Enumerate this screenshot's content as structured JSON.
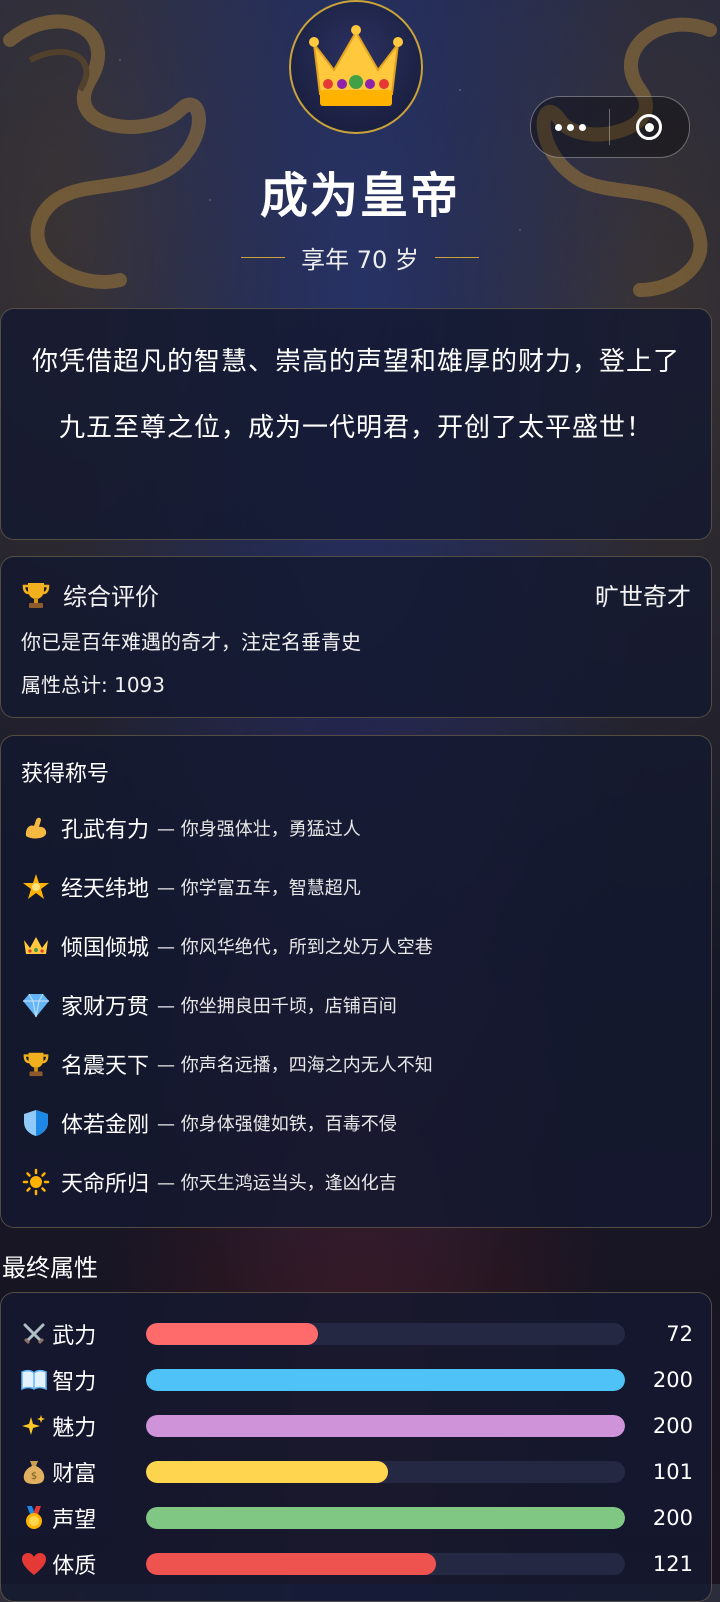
{
  "capsule": {
    "more_icon": "more-dots-icon",
    "close_icon": "target-close-icon"
  },
  "header": {
    "avatar_icon": "crown-icon",
    "title": "成为皇帝",
    "age": "享年 70 岁"
  },
  "description": "你凭借超凡的智慧、崇高的声望和雄厚的财力，登上了九五至尊之位，成为一代明君，开创了太平盛世！",
  "evaluation": {
    "icon": "trophy-icon",
    "label": "综合评价",
    "rank": "旷世奇才",
    "comment": "你已是百年难遇的奇才，注定名垂青史",
    "total": "属性总计: 1093"
  },
  "titles": {
    "heading": "获得称号",
    "items": [
      {
        "icon": "flexed-biceps-icon",
        "name": "孔武有力",
        "desc": "— 你身强体壮，勇猛过人"
      },
      {
        "icon": "glowing-star-icon",
        "name": "经天纬地",
        "desc": "— 你学富五车，智慧超凡"
      },
      {
        "icon": "crown-icon",
        "name": "倾国倾城",
        "desc": "— 你风华绝代，所到之处万人空巷"
      },
      {
        "icon": "gem-icon",
        "name": "家财万贯",
        "desc": "— 你坐拥良田千顷，店铺百间"
      },
      {
        "icon": "trophy-icon",
        "name": "名震天下",
        "desc": "— 你声名远播，四海之内无人不知"
      },
      {
        "icon": "shield-icon",
        "name": "体若金刚",
        "desc": "— 你身体强健如铁，百毒不侵"
      },
      {
        "icon": "sun-icon",
        "name": "天命所归",
        "desc": "— 你天生鸿运当头，逢凶化吉"
      }
    ]
  },
  "attributes": {
    "heading": "最终属性",
    "max": 200,
    "items": [
      {
        "icon": "crossed-swords-icon",
        "label": "武力",
        "value": 72,
        "color": "#ff6b6b"
      },
      {
        "icon": "open-book-icon",
        "label": "智力",
        "value": 200,
        "color": "#4fc3f7"
      },
      {
        "icon": "sparkles-icon",
        "label": "魅力",
        "value": 200,
        "color": "#ce93d8"
      },
      {
        "icon": "money-bag-icon",
        "label": "财富",
        "value": 101,
        "color": "#ffd54f"
      },
      {
        "icon": "medal-icon",
        "label": "声望",
        "value": 200,
        "color": "#81c784"
      },
      {
        "icon": "heart-icon",
        "label": "体质",
        "value": 121,
        "color": "#ef5350"
      }
    ]
  }
}
